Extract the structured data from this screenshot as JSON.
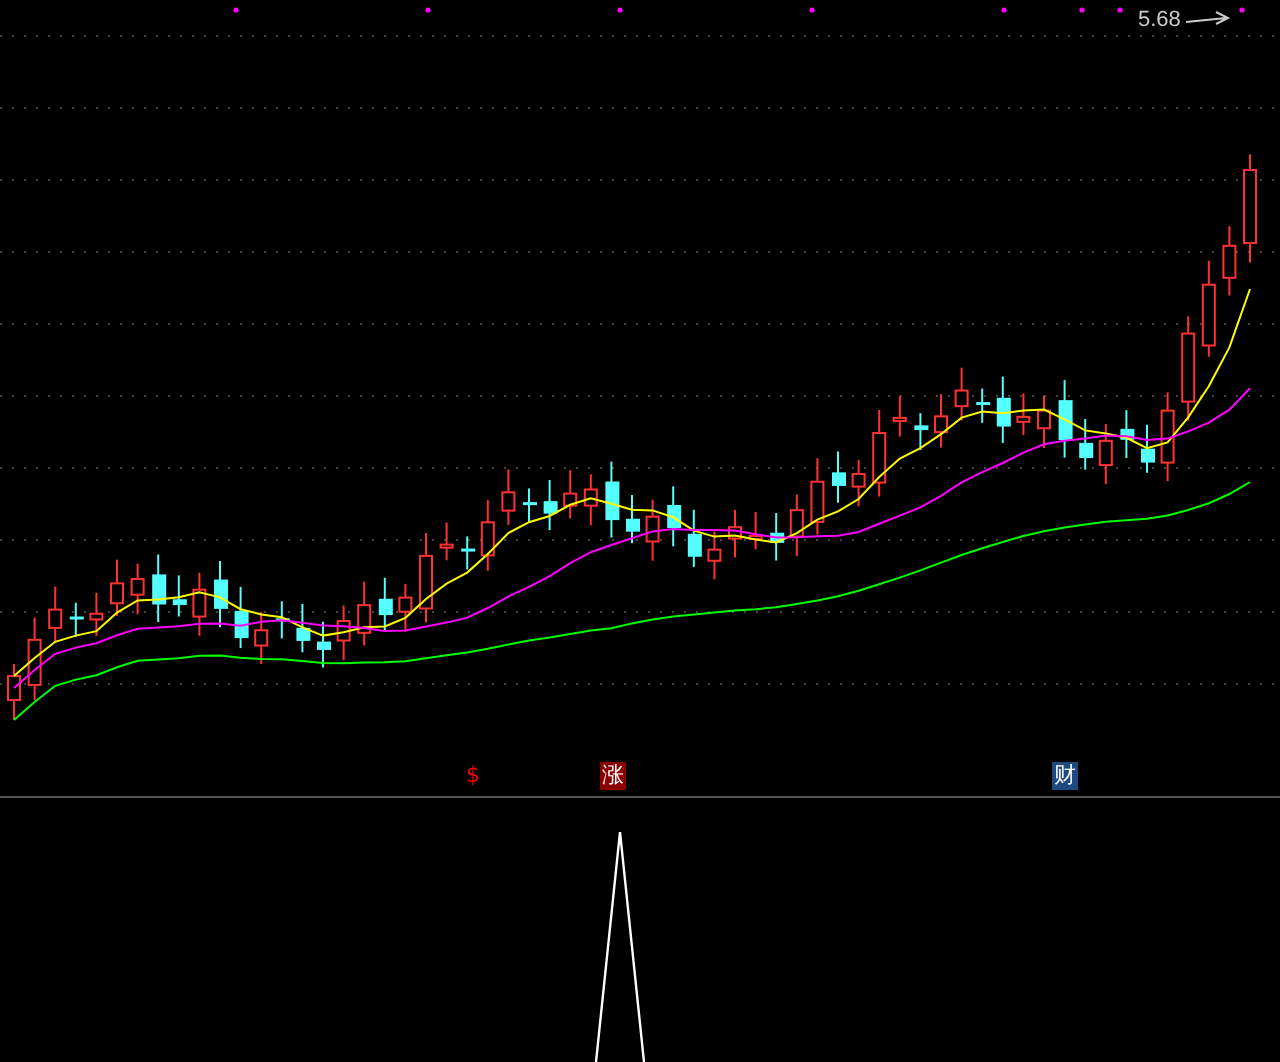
{
  "price_chart": {
    "high_label": "5.68"
  },
  "signal_markers": [
    {
      "text": "$",
      "kind": "plain",
      "color": "#ff0000"
    },
    {
      "text": "涨",
      "kind": "boxed",
      "color": "#8b0000"
    },
    {
      "text": "财",
      "kind": "boxed",
      "color": "#1e4a80"
    }
  ]
}
